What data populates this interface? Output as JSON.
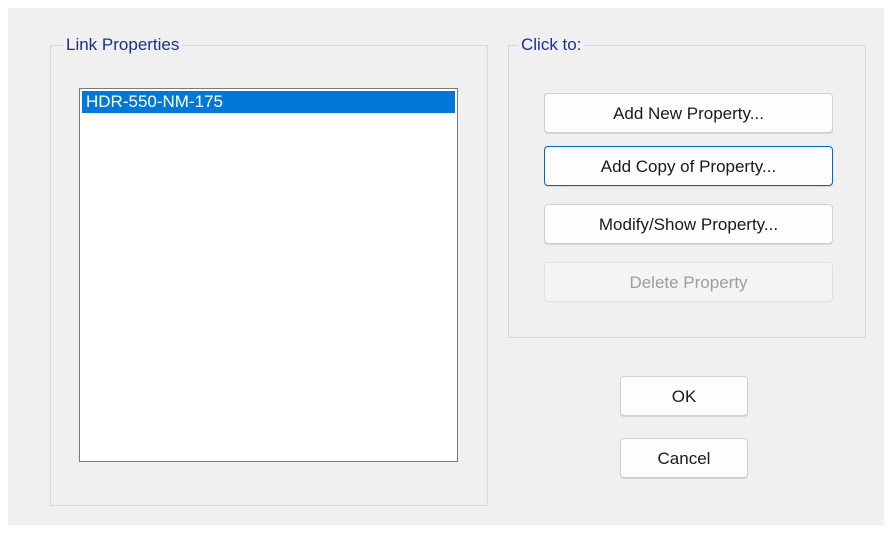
{
  "link_properties": {
    "legend": "Link Properties",
    "items": [
      {
        "label": "HDR-550-NM-175",
        "selected": true
      }
    ]
  },
  "click_to": {
    "legend": "Click to:",
    "add_new_label": "Add New Property...",
    "add_copy_label": "Add Copy of Property...",
    "modify_show_label": "Modify/Show Property...",
    "delete_label": "Delete Property"
  },
  "dialog_buttons": {
    "ok_label": "OK",
    "cancel_label": "Cancel"
  },
  "colors": {
    "dialog_background": "#f0f0f0",
    "legend_text": "#1c2f8c",
    "selection_background": "#0078d7",
    "focus_border": "#0067c0",
    "disabled_text": "#9d9d9d"
  }
}
